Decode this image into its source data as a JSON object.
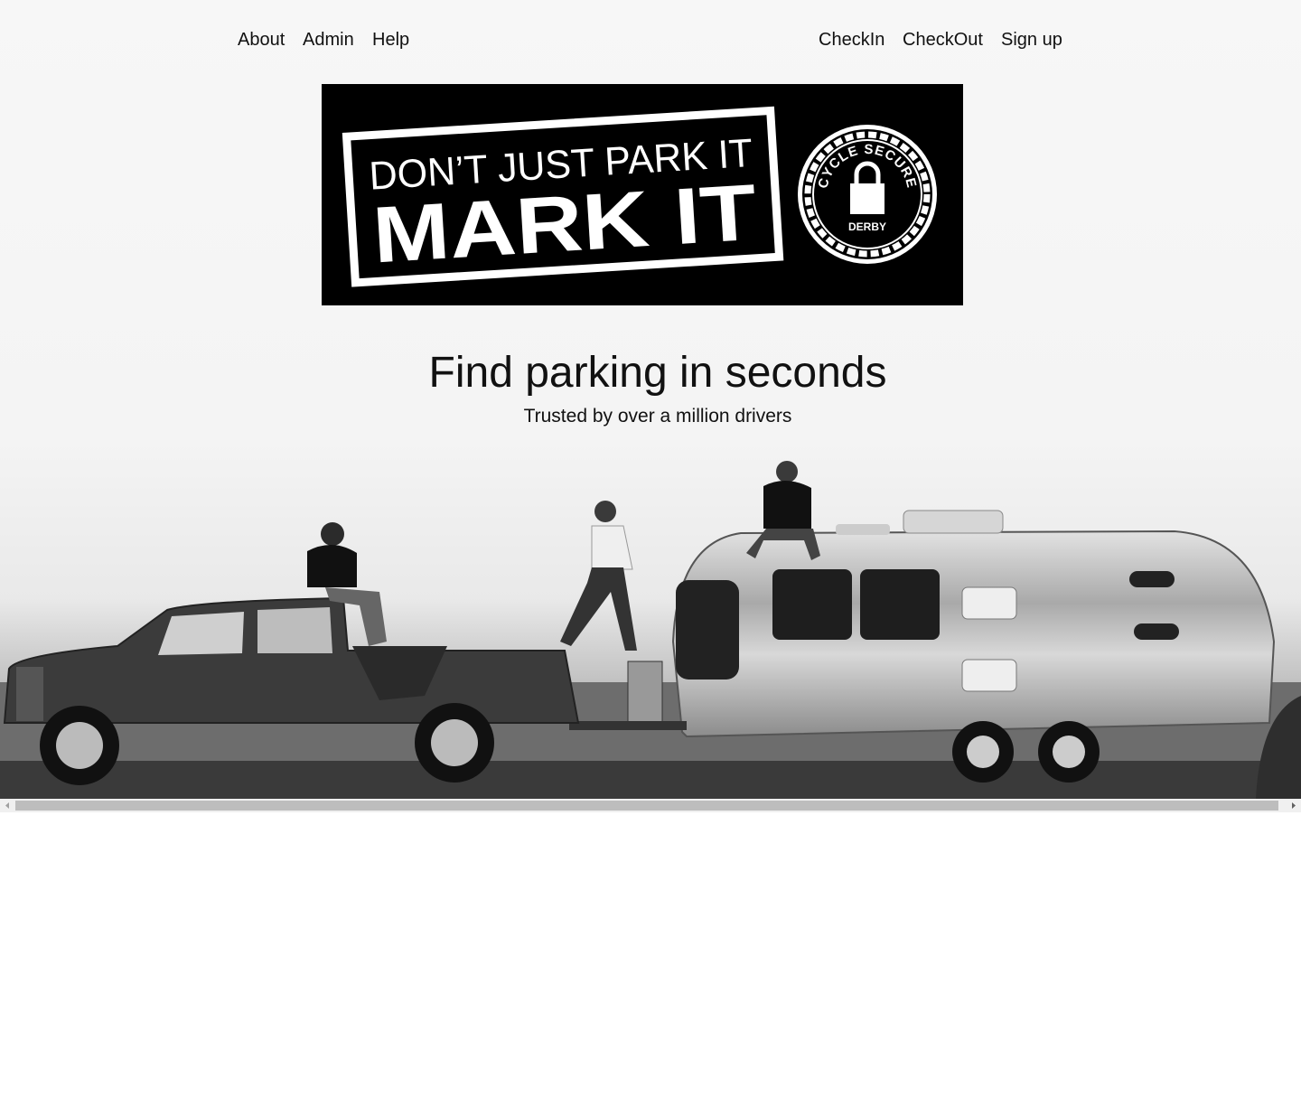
{
  "nav": {
    "left": [
      {
        "label": "About"
      },
      {
        "label": "Admin"
      },
      {
        "label": "Help"
      }
    ],
    "right": [
      {
        "label": "CheckIn"
      },
      {
        "label": "CheckOut"
      },
      {
        "label": "Sign up"
      }
    ]
  },
  "banner": {
    "line1": "DON’T JUST PARK IT",
    "line2": "MARK IT",
    "seal_arc": "CYCLE SECURE",
    "seal_bottom": "DERBY"
  },
  "hero": {
    "title": "Find parking in seconds",
    "subtitle": "Trusted by over a million drivers"
  },
  "colors": {
    "banner_bg": "#000000",
    "text": "#111111"
  }
}
